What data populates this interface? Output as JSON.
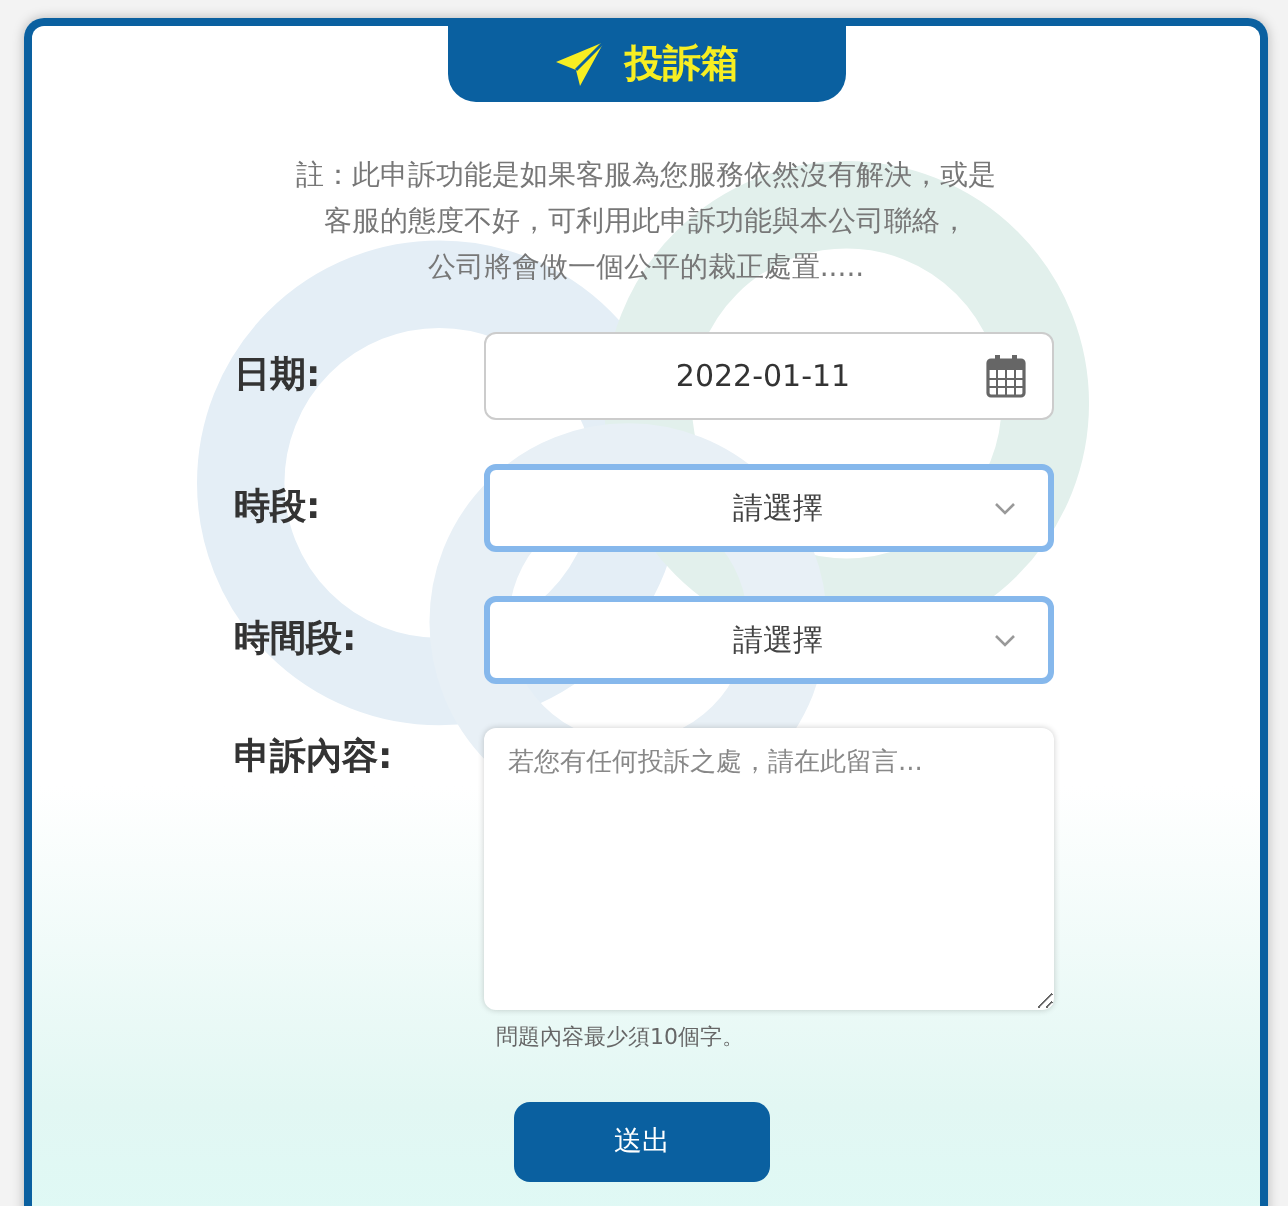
{
  "header": {
    "title": "投訴箱"
  },
  "note_lines": [
    "註：此申訴功能是如果客服為您服務依然沒有解決，或是",
    "客服的態度不好，可利用此申訴功能與本公司聯絡，",
    "公司將會做一個公平的裁正處置....."
  ],
  "fields": [
    {
      "kind": "date",
      "label": "日期:",
      "value": "2022-01-11"
    },
    {
      "kind": "select",
      "label": "時段:",
      "value": "請選擇"
    },
    {
      "kind": "select",
      "label": "時間段:",
      "value": "請選擇"
    },
    {
      "kind": "textarea",
      "label": "申訴內容:",
      "placeholder": "若您有任何投訴之處，請在此留言...",
      "hint": "問題內容最少須10個字。"
    }
  ],
  "submit_button": "送出"
}
